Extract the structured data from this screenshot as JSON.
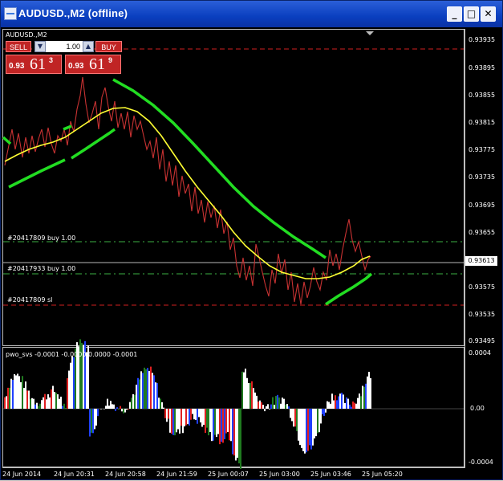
{
  "window": {
    "title": "AUDUSD.,M2 (offline)",
    "minimize": "_",
    "maximize": "□",
    "close": "✕"
  },
  "chart": {
    "symbol_label": "AUDUSD.,M2",
    "current_price": "0.93613",
    "y_labels": [
      "0.93935",
      "0.93895",
      "0.93855",
      "0.93815",
      "0.93775",
      "0.93735",
      "0.93695",
      "0.93655",
      "0.93575",
      "0.93535",
      "0.93495"
    ],
    "x_labels": [
      "24 Jun 2014",
      "24 Jun 20:31",
      "24 Jun 20:58",
      "24 Jun 21:59",
      "25 Jun 00:07",
      "25 Jun 03:00",
      "25 Jun 03:46",
      "25 Jun 05:20"
    ],
    "order_lines": [
      "#20417809 buy 1.00",
      "#20417933 buy 1.00",
      "#20417809 sl"
    ],
    "indicator_label": "pwo_svs -0.0001 -0.0000 0.0000 -0.0001",
    "indicator_levels": [
      "0.0004",
      "0.00",
      "-0.0004"
    ]
  },
  "trade_panel": {
    "sell_label": "SELL",
    "buy_label": "BUY",
    "lot": "1.00",
    "down_arrow": "▼",
    "up_arrow": "▲",
    "sell_small": "0.93",
    "sell_big": "61",
    "sell_sup": "3",
    "buy_small": "0.93",
    "buy_big": "61",
    "buy_sup": "9"
  },
  "colors": {
    "background": "#000000",
    "candle": "#c83232",
    "green_ma": "#22dd22",
    "yellow_ma": "#ffff33",
    "buy_line": "#3cb043",
    "sl_line": "#e02020"
  }
}
